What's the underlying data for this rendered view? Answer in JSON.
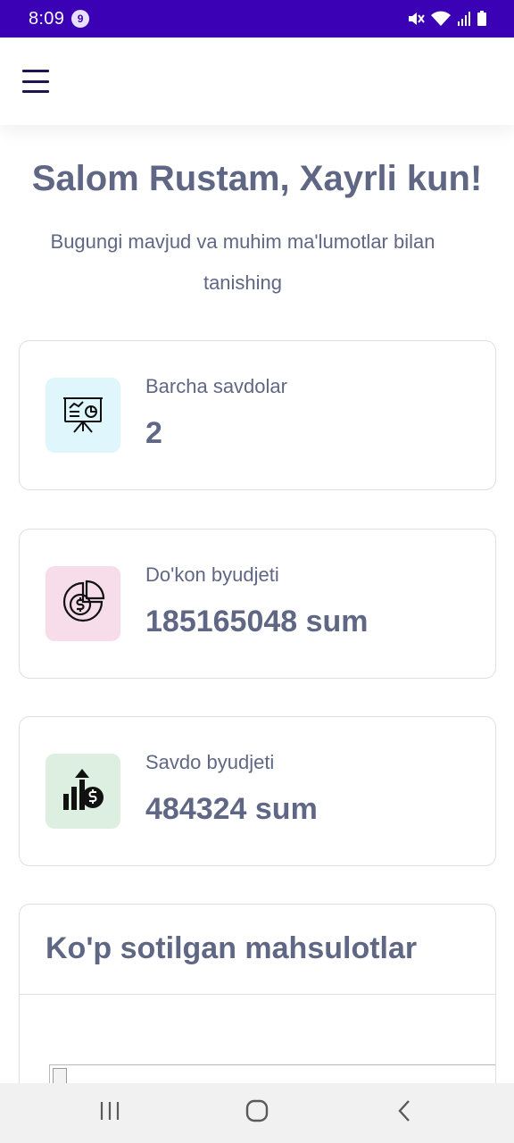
{
  "status_bar": {
    "time": "8:09",
    "notification_count": "9",
    "icons": [
      "mute-icon",
      "wifi-icon",
      "signal-icon",
      "battery-icon"
    ]
  },
  "header": {
    "menu_icon": "hamburger-menu-icon"
  },
  "greeting": {
    "title": "Salom Rustam, Xayrli kun!",
    "subtitle": "Bugungi mavjud va muhim ma'lumotlar bilan tanishing"
  },
  "stats": [
    {
      "label": "Barcha savdolar",
      "value": "2",
      "icon": "presentation-chart-icon",
      "icon_bg": "#dff6fd"
    },
    {
      "label": "Do'kon byudjeti",
      "value": "185165048 sum",
      "icon": "budget-pie-chart-icon",
      "icon_bg": "#f7dde9"
    },
    {
      "label": "Savdo byudjeti",
      "value": "484324 sum",
      "icon": "sales-growth-icon",
      "icon_bg": "#dcefe1"
    }
  ],
  "top_products": {
    "title": "Ko'p sotilgan mahsulotlar"
  },
  "nav_bar": {
    "buttons": [
      "recent-apps-icon",
      "home-icon",
      "back-icon"
    ]
  },
  "colors": {
    "status_bar": "#3a02b4",
    "text": "#5f6785",
    "menu_icon": "#1b1652",
    "card_border": "#dcdfe6"
  }
}
